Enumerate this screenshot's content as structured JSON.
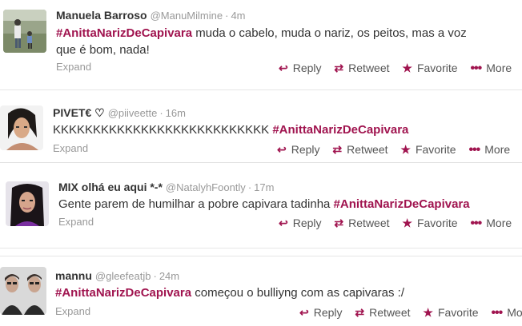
{
  "actions": {
    "reply": "Reply",
    "retweet": "Retweet",
    "favorite": "Favorite",
    "more": "More",
    "expand": "Expand"
  },
  "icons": {
    "reply": "reply-icon",
    "retweet": "retweet-icon",
    "favorite": "star-icon",
    "more": "more-dots-icon"
  },
  "colors": {
    "hashtag": "#a0144f",
    "action_icon": "#a0144f",
    "muted": "#999999"
  },
  "tweets": [
    {
      "name": "Manuela Barroso",
      "handle": "@ManuMilmine",
      "time": "4m",
      "hashtag": "#AnittaNarizDeCapivara",
      "text_before": "",
      "text_after": " muda o cabelo, muda o nariz, os peitos, mas a voz que é bom, nada!"
    },
    {
      "name": "PIVET€ ♡",
      "handle": "@piiveette",
      "time": "16m",
      "hashtag": "#AnittaNarizDeCapivara",
      "text_before": "KKKKKKKKKKKKKKKKKKKKKKKKKKK ",
      "text_after": ""
    },
    {
      "name": "MIX olhá eu aqui *-*",
      "handle": "@NatalyhFoontly",
      "time": "17m",
      "hashtag": "#AnittaNarizDeCapivara",
      "text_before": "Gente parem de humilhar a pobre capivara tadinha ",
      "text_after": ""
    },
    {
      "name": "mannu",
      "handle": "@gleefeatjb",
      "time": "24m",
      "hashtag": "#AnittaNarizDeCapivara",
      "text_before": "",
      "text_after": " começou o bulliyng com as capivaras :/"
    }
  ]
}
